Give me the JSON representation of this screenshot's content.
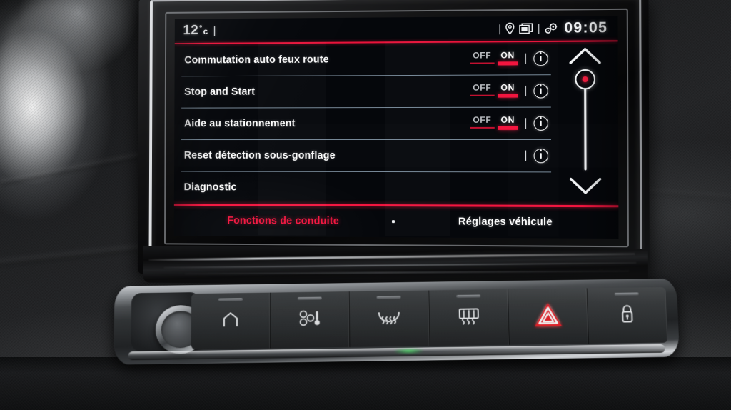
{
  "screen": {
    "status_bar": {
      "temperature": "12",
      "degree_symbol": "°",
      "temperature_unit": "c",
      "separator": "|",
      "icons": [
        "location-pin-icon",
        "windows-stack-icon",
        "gears-icon"
      ],
      "clock": "09:05"
    },
    "menu_rows": [
      {
        "label": "Commutation auto feux route",
        "off_label": "OFF",
        "on_label": "ON",
        "selected": "ON",
        "has_toggle": true,
        "has_info": true
      },
      {
        "label": "Stop and Start",
        "off_label": "OFF",
        "on_label": "ON",
        "selected": "ON",
        "has_toggle": true,
        "has_info": true
      },
      {
        "label": "Aide au stationnement",
        "off_label": "OFF",
        "on_label": "ON",
        "selected": "ON",
        "has_toggle": true,
        "has_info": true
      },
      {
        "label": "Reset détection sous-gonflage",
        "off_label": "",
        "on_label": "",
        "selected": "",
        "has_toggle": false,
        "has_info": true
      },
      {
        "label": "Diagnostic",
        "off_label": "",
        "on_label": "",
        "selected": "",
        "has_toggle": false,
        "has_info": false
      }
    ],
    "scrollbar": {
      "up_arrow": "chevron-up-icon",
      "down_arrow": "chevron-down-icon",
      "thumb_position": "top"
    },
    "tabs": [
      {
        "label": "Fonctions de conduite",
        "active": true
      },
      {
        "label": "Réglages véhicule",
        "active": false
      }
    ],
    "colors": {
      "accent_red": "#f4153f",
      "dim_red": "#c21030",
      "text_white": "#fdfdfd",
      "divider_blue": "#9fb6c8",
      "screen_bg": "#05070b"
    }
  },
  "hardware": {
    "rotary_knob": "volume-knob",
    "buttons": [
      {
        "name": "home-button",
        "icon": "home-icon"
      },
      {
        "name": "climate-button",
        "icon": "fan-thermometer-icon"
      },
      {
        "name": "windshield-defrost-button",
        "icon": "windshield-defrost-icon"
      },
      {
        "name": "rear-defrost-button",
        "icon": "rear-defrost-icon"
      },
      {
        "name": "hazard-button",
        "icon": "hazard-triangle-icon",
        "color": "#e8202a"
      },
      {
        "name": "door-lock-button",
        "icon": "lock-icon"
      }
    ]
  }
}
